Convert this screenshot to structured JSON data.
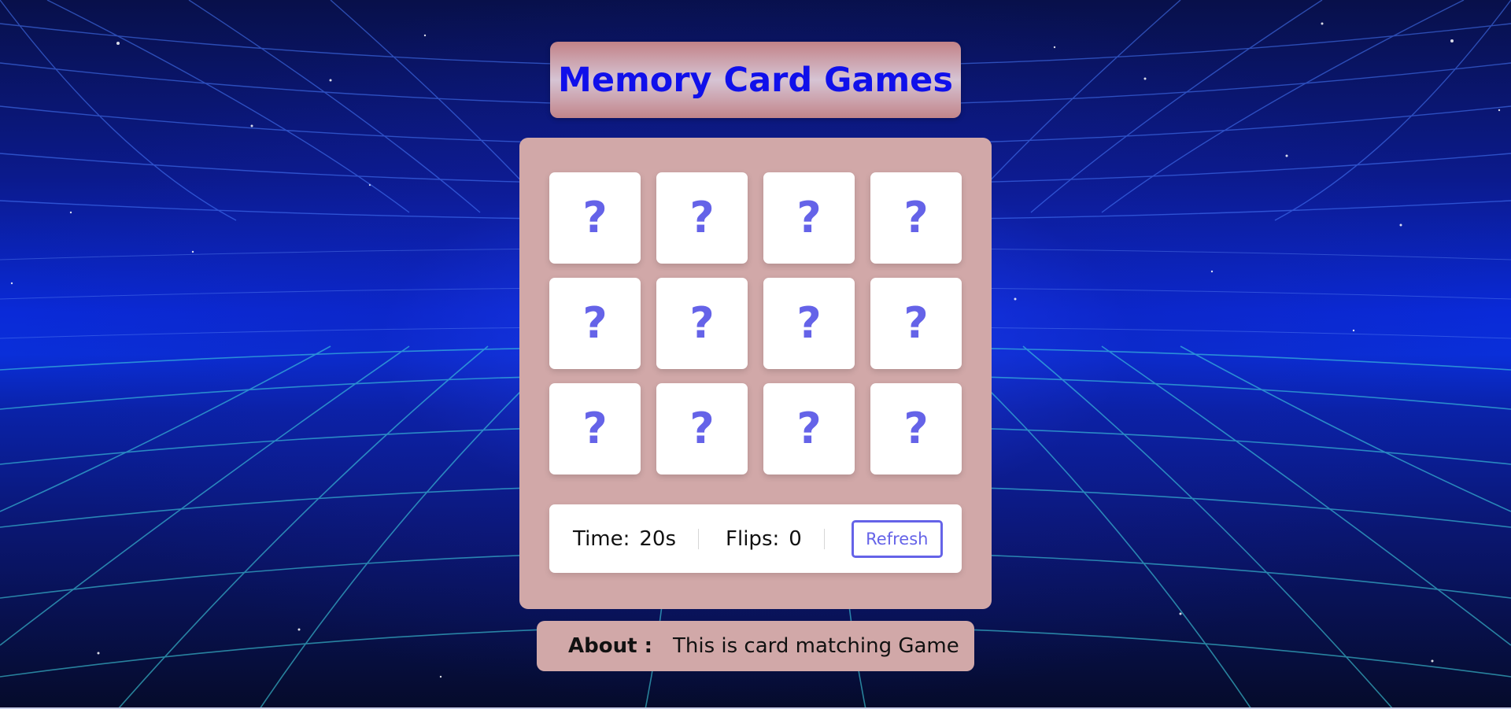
{
  "title": "Memory Card Games",
  "cards": [
    {
      "face": "?"
    },
    {
      "face": "?"
    },
    {
      "face": "?"
    },
    {
      "face": "?"
    },
    {
      "face": "?"
    },
    {
      "face": "?"
    },
    {
      "face": "?"
    },
    {
      "face": "?"
    },
    {
      "face": "?"
    },
    {
      "face": "?"
    },
    {
      "face": "?"
    },
    {
      "face": "?"
    }
  ],
  "status": {
    "time_label": "Time:",
    "time_value": "20s",
    "flips_label": "Flips:",
    "flips_value": "0",
    "refresh_label": "Refresh"
  },
  "about": {
    "label": "About :",
    "text": "This is card matching Game"
  },
  "colors": {
    "title_text": "#1010ea",
    "panel": "#d1a8a8",
    "accent": "#6563e8",
    "card": "#ffffff"
  },
  "icons": {
    "card_back": "question-mark-icon"
  }
}
